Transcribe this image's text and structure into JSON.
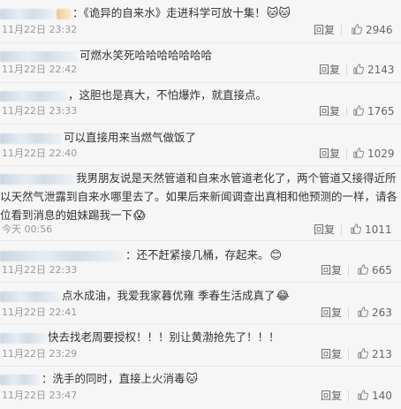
{
  "comments": [
    {
      "text": "：《诡异的自来水》走进科学可放十集！",
      "emoji": "🐱🐱",
      "time": "11月22日 23:32",
      "reply": "回复",
      "likes": "2946"
    },
    {
      "text": "可燃水笑死哈哈哈哈哈哈哈",
      "emoji": "",
      "time": "11月22日 22:42",
      "reply": "回复",
      "likes": "2143"
    },
    {
      "text": "，这胆也是真大，不怕爆炸，就直接点。",
      "emoji": "",
      "time": "11月22日 23:33",
      "reply": "回复",
      "likes": "1765"
    },
    {
      "text": "可以直接用来当燃气做饭了",
      "emoji": "",
      "time": "11月22日 22:40",
      "reply": "回复",
      "likes": "1029"
    },
    {
      "text": "我男朋友说是天然管道和自来水管道老化了，两个管道又接得近所以天然气泄露到自来水哪里去了。如果后来新闻调查出真相和他预测的一样，请各位看到消息的姐妹踢我一下",
      "emoji": "😱",
      "time": "今天 00:56",
      "reply": "回复",
      "likes": "1011"
    },
    {
      "text": "：还不赶紧接几桶，存起来。",
      "emoji": "😊",
      "time": "11月22日 22:33",
      "reply": "回复",
      "likes": "665"
    },
    {
      "text": "点水成油，我爱我家暮优雍 季春生活成真了",
      "emoji": "😂",
      "time": "11月22日 22:41",
      "reply": "回复",
      "likes": "263"
    },
    {
      "text": "快去找老周要授权！！！别让黄渤抢先了！！！",
      "emoji": "",
      "time": "11月22日 23:29",
      "reply": "回复",
      "likes": "213"
    },
    {
      "text": "：洗手的同时，直接上火消毒",
      "emoji": "🐱",
      "time": "11月22日 23:47",
      "reply": "回复",
      "likes": "140"
    }
  ]
}
